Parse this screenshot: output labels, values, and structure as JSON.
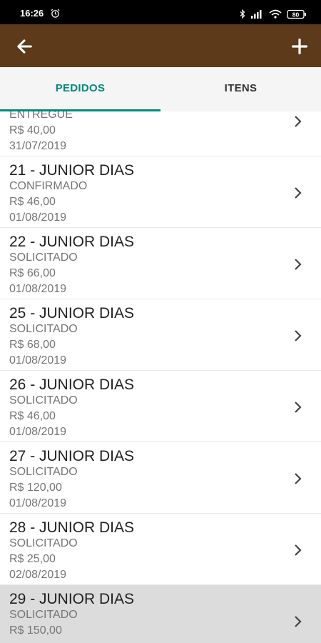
{
  "status_bar": {
    "time": "16:26",
    "battery": "80"
  },
  "app_bar": {
    "back_icon": "arrow-left-icon",
    "add_icon": "plus-icon",
    "color": "#5d3a1a"
  },
  "tabs": [
    {
      "label": "PEDIDOS",
      "active": true
    },
    {
      "label": "ITENS",
      "active": false
    }
  ],
  "accent_color": "#00897b",
  "orders": [
    {
      "title": "",
      "status": "ENTREGUE",
      "value": "R$ 40,00",
      "date": "31/07/2019"
    },
    {
      "title": "21 - JUNIOR DIAS",
      "status": "CONFIRMADO",
      "value": "R$ 46,00",
      "date": "01/08/2019"
    },
    {
      "title": "22 - JUNIOR DIAS",
      "status": "SOLICITADO",
      "value": "R$ 66,00",
      "date": "01/08/2019"
    },
    {
      "title": "25 - JUNIOR DIAS",
      "status": "SOLICITADO",
      "value": "R$ 68,00",
      "date": "01/08/2019"
    },
    {
      "title": "26 - JUNIOR DIAS",
      "status": "SOLICITADO",
      "value": "R$ 46,00",
      "date": "01/08/2019"
    },
    {
      "title": "27 - JUNIOR DIAS",
      "status": "SOLICITADO",
      "value": "R$ 120,00",
      "date": "01/08/2019"
    },
    {
      "title": "28 - JUNIOR DIAS",
      "status": "SOLICITADO",
      "value": "R$ 25,00",
      "date": "02/08/2019"
    },
    {
      "title": "29 - JUNIOR DIAS",
      "status": "SOLICITADO",
      "value": "R$ 150,00",
      "date": ""
    }
  ]
}
